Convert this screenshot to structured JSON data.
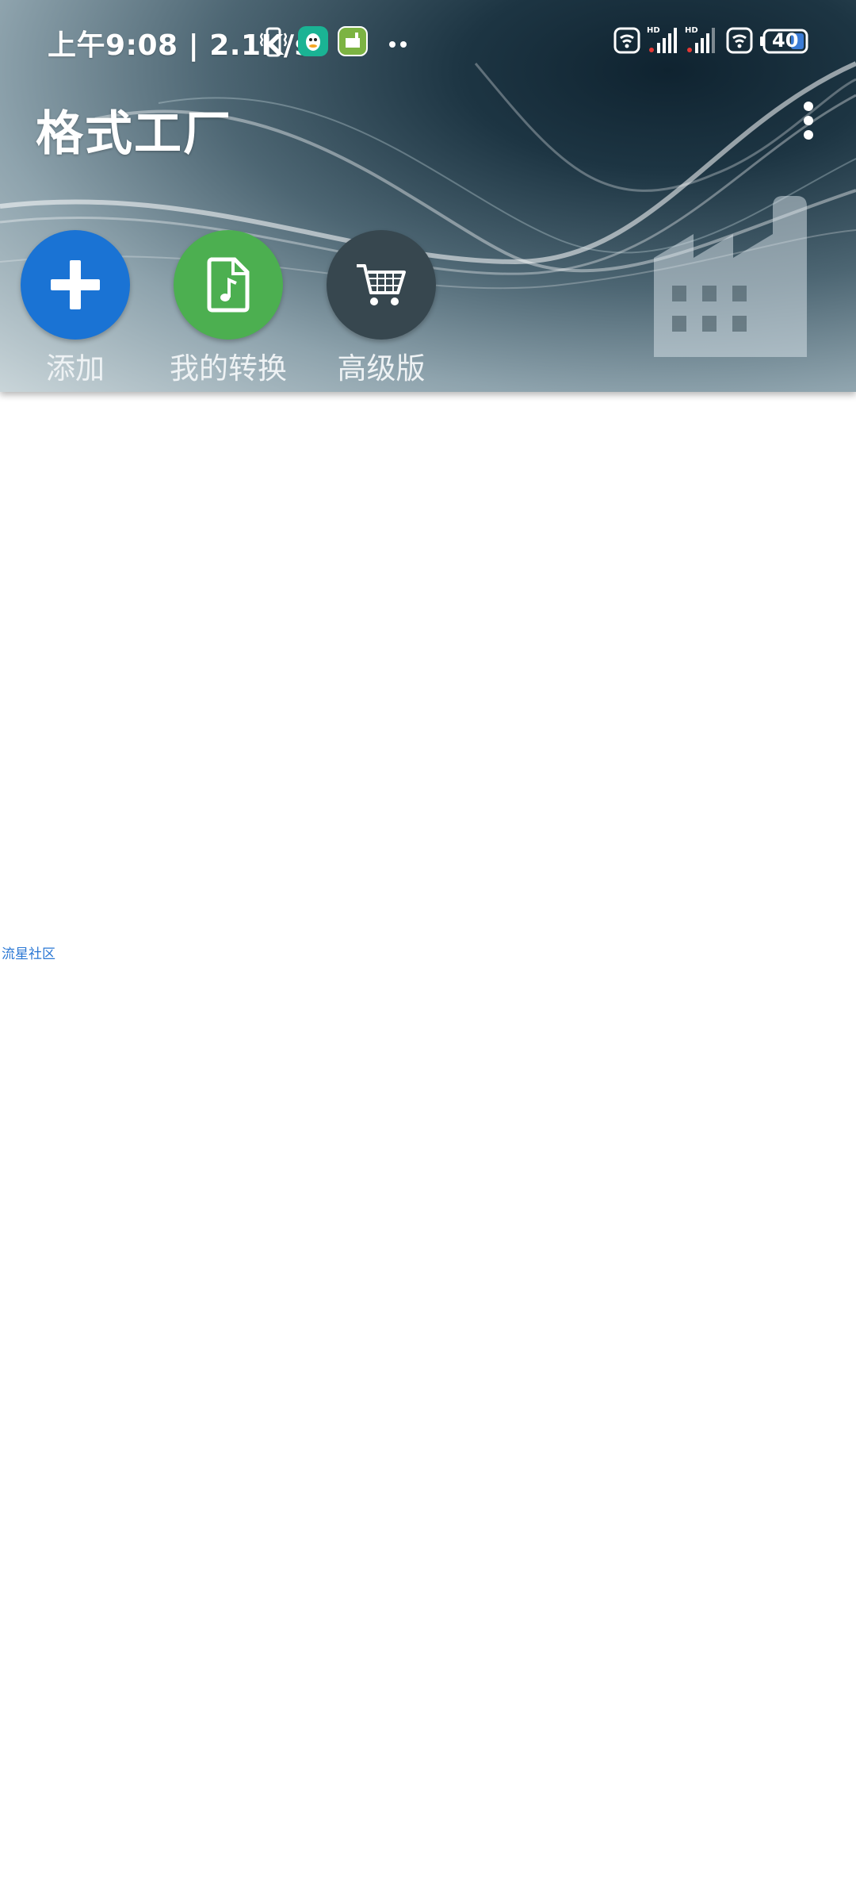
{
  "status_bar": {
    "time_speed": "上午9:08 | 2.1K/s",
    "battery": "40"
  },
  "header": {
    "title": "格式工厂"
  },
  "actions": [
    {
      "label": "添加",
      "color": "#1a73d4"
    },
    {
      "label": "我的转换",
      "color": "#4caf50"
    },
    {
      "label": "高级版",
      "color": "#37474f"
    }
  ],
  "watermark": "流星社区"
}
